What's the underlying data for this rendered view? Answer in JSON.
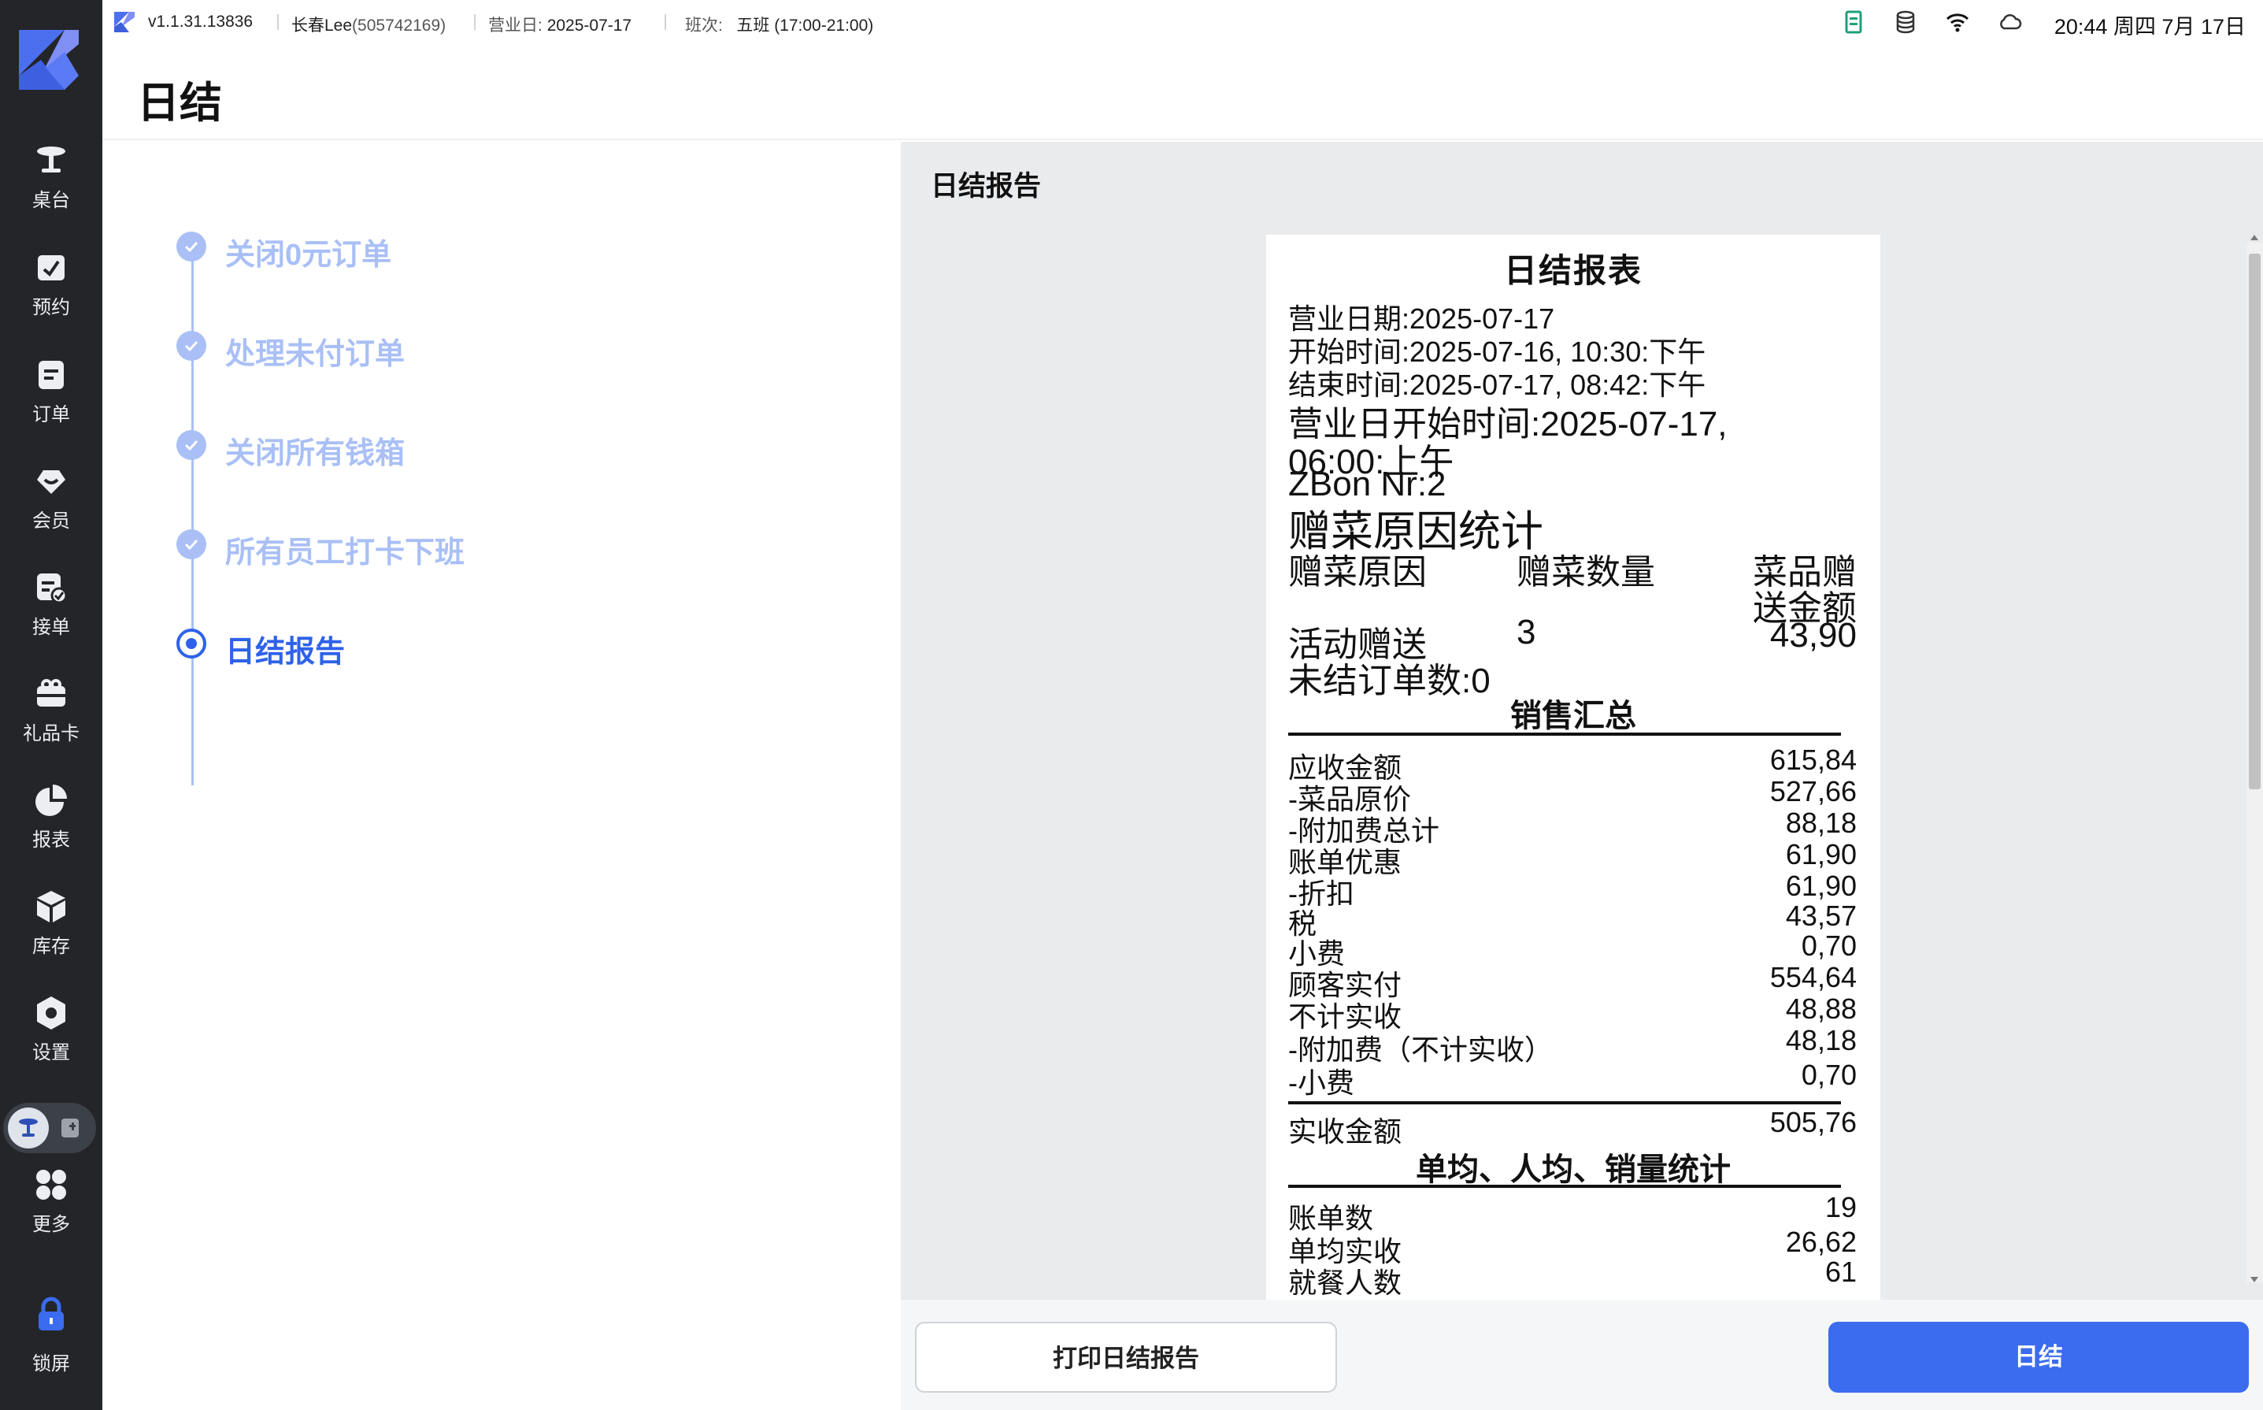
{
  "status_bar": {
    "version": "v1.1.31.13836",
    "user_name": "长春Lee",
    "user_id": "(505742169)",
    "business_day_label": "营业日:",
    "business_day_value": "2025-07-17",
    "shift_label": "班次:",
    "shift_value": "五班 (17:00-21:00)",
    "clock": "20:44 周四 7月 17日"
  },
  "page": {
    "title": "日结"
  },
  "sidebar": {
    "items": [
      {
        "label": "桌台",
        "icon": "table-icon"
      },
      {
        "label": "预约",
        "icon": "reservation-icon"
      },
      {
        "label": "订单",
        "icon": "order-icon"
      },
      {
        "label": "会员",
        "icon": "member-icon"
      },
      {
        "label": "接单",
        "icon": "accept-order-icon"
      },
      {
        "label": "礼品卡",
        "icon": "gift-card-icon"
      },
      {
        "label": "报表",
        "icon": "report-icon"
      },
      {
        "label": "库存",
        "icon": "inventory-icon"
      },
      {
        "label": "设置",
        "icon": "settings-icon"
      },
      {
        "label": "更多",
        "icon": "more-icon"
      },
      {
        "label": "锁屏",
        "icon": "lock-icon"
      }
    ]
  },
  "steps": [
    {
      "label": "关闭0元订单",
      "state": "done"
    },
    {
      "label": "处理未付订单",
      "state": "done"
    },
    {
      "label": "关闭所有钱箱",
      "state": "done"
    },
    {
      "label": "所有员工打卡下班",
      "state": "done"
    },
    {
      "label": "日结报告",
      "state": "active"
    }
  ],
  "report": {
    "heading": "日结报告",
    "receipt": {
      "title": "日结报表",
      "business_date": "营业日期:2025-07-17",
      "start_time": "开始时间:2025-07-16, 10:30:下午",
      "end_time": "结束时间:2025-07-17, 08:42:下午",
      "business_day_start_1": "营业日开始时间:2025-07-17,",
      "business_day_start_2": "06:00:上午",
      "zbon": "ZBon Nr:2",
      "gift_section_title": "赠菜原因统计",
      "gift_headers": [
        "赠菜原因",
        "赠菜数量",
        "菜品赠",
        "送金额"
      ],
      "gift_row": {
        "reason": "活动赠送",
        "qty": "3",
        "amount": "43,90"
      },
      "unsettled_orders": "未结订单数:0",
      "sales_summary_title": "销售汇总",
      "sales_rows": [
        {
          "label": "应收金额",
          "value": "615,84"
        },
        {
          "label": " -菜品原价",
          "value": "527,66"
        },
        {
          "label": " -附加费总计",
          "value": "88,18"
        },
        {
          "label": "账单优惠",
          "value": "61,90"
        },
        {
          "label": " -折扣",
          "value": "61,90"
        },
        {
          "label": "税",
          "value": "43,57"
        },
        {
          "label": "小费",
          "value": "0,70"
        },
        {
          "label": "顾客实付",
          "value": "554,64"
        },
        {
          "label": "不计实收",
          "value": "48,88"
        },
        {
          "label": " -附加费（不计实收）",
          "value": "48,18"
        },
        {
          "label": " -小费",
          "value": "0,70"
        }
      ],
      "actual_income": {
        "label": "实收金额",
        "value": "505,76"
      },
      "avg_section_title": "单均、人均、销量统计",
      "avg_rows": [
        {
          "label": "账单数",
          "value": "19"
        },
        {
          "label": "单均实收",
          "value": "26,62"
        },
        {
          "label": "就餐人数",
          "value": "61"
        }
      ]
    }
  },
  "footer": {
    "print_label": "打印日结报告",
    "close_day_label": "日结"
  },
  "colors": {
    "accent": "#3b6cf0",
    "step_done": "#a9bff6",
    "sidebar_bg": "#232529"
  }
}
